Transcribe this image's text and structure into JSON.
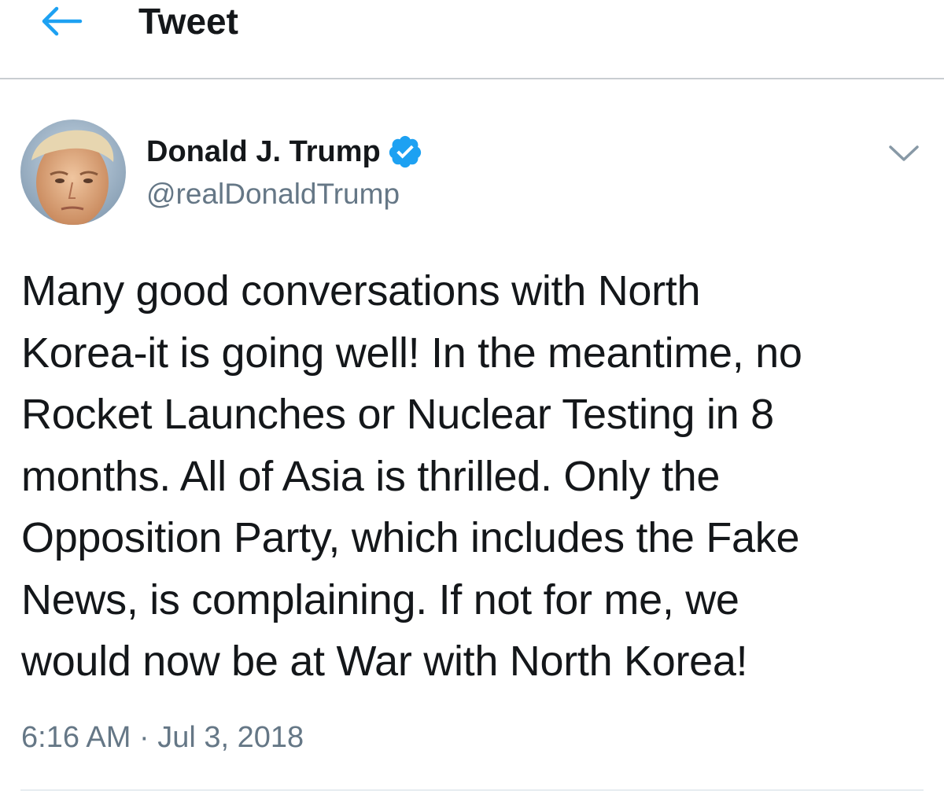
{
  "header": {
    "title": "Tweet"
  },
  "tweet": {
    "author": {
      "name": "Donald J. Trump",
      "handle": "@realDonaldTrump",
      "verified": true
    },
    "text": "Many good conversations with North\nKorea-it is going well! In the meantime, no\nRocket Launches or Nuclear Testing in 8\nmonths. All of Asia is thrilled. Only the\nOpposition Party, which includes the Fake\nNews, is complaining. If not for me, we\nwould now be at War with North Korea!",
    "time": "6:16 AM",
    "separator": "·",
    "date": "Jul 3, 2018"
  },
  "colors": {
    "accent": "#1da1f2",
    "text": "#14171a",
    "secondary_text": "#657786",
    "divider": "#c9cdd1"
  },
  "icons": {
    "back": "arrow-left-icon",
    "verified": "verified-badge-icon",
    "more": "chevron-down-icon"
  }
}
